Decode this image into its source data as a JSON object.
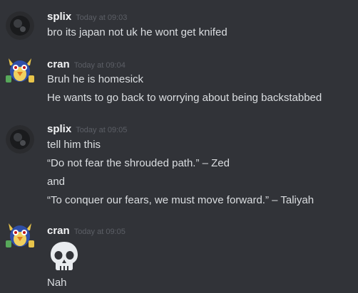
{
  "messages": [
    {
      "author": "splix",
      "timestamp": "Today at 09:03",
      "avatar_icon": "dark-avatar",
      "lines": [
        "bro its japan not uk he wont get knifed"
      ]
    },
    {
      "author": "cran",
      "timestamp": "Today at 09:04",
      "avatar_icon": "cartoon-bird-avatar",
      "lines": [
        "Bruh he is homesick",
        "He wants to go back to worrying about being backstabbed"
      ]
    },
    {
      "author": "splix",
      "timestamp": "Today at 09:05",
      "avatar_icon": "dark-avatar",
      "lines": [
        "tell him this",
        "“Do not fear the shrouded path.” – Zed",
        "and",
        "“To conquer our fears, we must move forward.” – Taliyah"
      ]
    },
    {
      "author": "cran",
      "timestamp": "Today at 09:05",
      "avatar_icon": "cartoon-bird-avatar",
      "emoji": "skull-emoji",
      "lines": [
        "Nah"
      ]
    }
  ],
  "colors": {
    "background": "#313338",
    "username": "#f2f3f5",
    "timestamp": "#5c5f66",
    "text": "#dbdee1"
  }
}
